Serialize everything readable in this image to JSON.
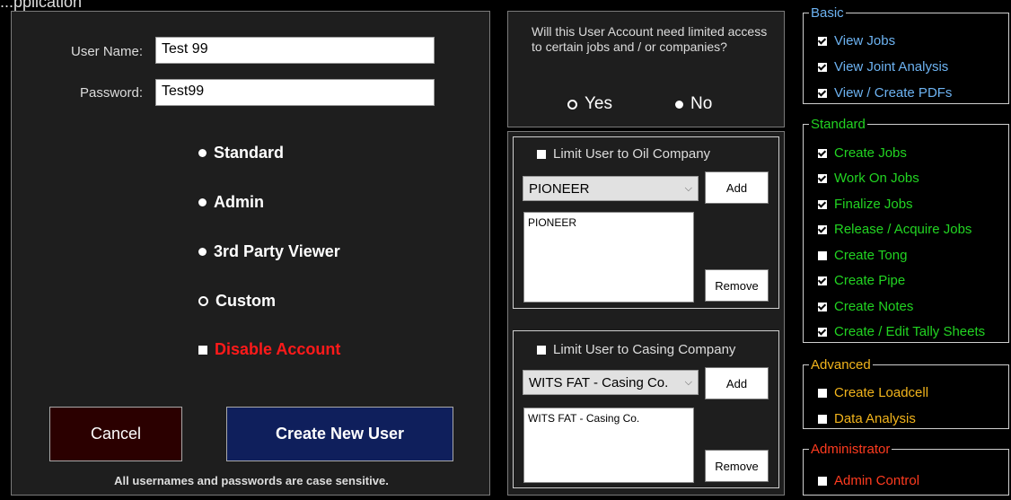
{
  "window": {
    "title_partial": "...pplication"
  },
  "left": {
    "username_label": "User Name:",
    "username_value": "Test 99",
    "password_label": "Password:",
    "password_value": "Test99",
    "roles": [
      {
        "label": "Standard",
        "selected": false
      },
      {
        "label": "Admin",
        "selected": false
      },
      {
        "label": "3rd Party Viewer",
        "selected": false
      },
      {
        "label": "Custom",
        "selected": true
      }
    ],
    "disable_label": "Disable Account",
    "cancel_label": "Cancel",
    "create_label": "Create New User",
    "note": "All usernames and passwords are case sensitive."
  },
  "middle": {
    "question": "Will this User Account need limited access to certain jobs and / or companies?",
    "yes_label": "Yes",
    "no_label": "No",
    "no_selected": true,
    "oil": {
      "limit_label": "Limit User to Oil Company",
      "select_value": "PIONEER",
      "add_label": "Add",
      "list_items": [
        "PIONEER"
      ],
      "remove_label": "Remove"
    },
    "casing": {
      "limit_label": "Limit User to Casing Company",
      "select_value": "WITS FAT - Casing Co.",
      "add_label": "Add",
      "list_items": [
        "WITS FAT - Casing Co."
      ],
      "remove_label": "Remove"
    }
  },
  "right": {
    "basic": {
      "title": "Basic",
      "color": "#6db3f2",
      "items": [
        {
          "label": "View Jobs",
          "checked": true
        },
        {
          "label": "View Joint Analysis",
          "checked": true
        },
        {
          "label": "View / Create PDFs",
          "checked": true
        }
      ]
    },
    "standard": {
      "title": "Standard",
      "color": "#22d422",
      "items": [
        {
          "label": "Create Jobs",
          "checked": true
        },
        {
          "label": "Work On Jobs",
          "checked": true
        },
        {
          "label": "Finalize Jobs",
          "checked": true
        },
        {
          "label": "Release / Acquire Jobs",
          "checked": true
        },
        {
          "label": "Create Tong",
          "checked": false
        },
        {
          "label": "Create Pipe",
          "checked": true
        },
        {
          "label": "Create Notes",
          "checked": true
        },
        {
          "label": "Create / Edit Tally Sheets",
          "checked": true
        }
      ]
    },
    "advanced": {
      "title": "Advanced",
      "color": "#f2b41c",
      "items": [
        {
          "label": "Create Loadcell",
          "checked": false
        },
        {
          "label": "Data Analysis",
          "checked": false
        }
      ]
    },
    "administrator": {
      "title": "Administrator",
      "color": "#ff3b1f",
      "items": [
        {
          "label": "Admin Control",
          "checked": false
        }
      ]
    }
  }
}
